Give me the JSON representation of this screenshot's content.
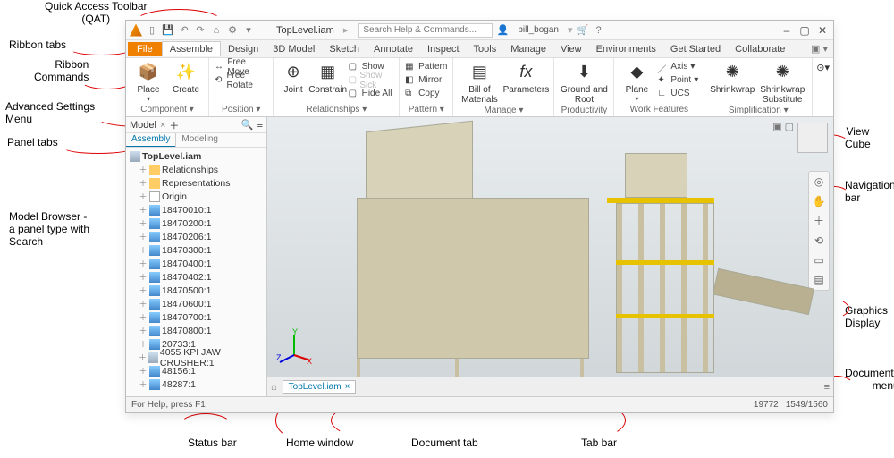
{
  "callouts": {
    "qat": "Quick Access Toolbar\n(QAT)",
    "ribbon_tabs": "Ribbon tabs",
    "ribbon_commands": "Ribbon\nCommands",
    "adv_settings": "Advanced Settings\nMenu",
    "panel_tabs": "Panel tabs",
    "model_browser": "Model Browser -\na panel type with\nSearch",
    "status_bar": "Status bar",
    "home_window": "Home window",
    "document_tab": "Document tab",
    "tab_bar": "Tab bar",
    "view_cube": "View\nCube",
    "nav_bar": "Navigation\nbar",
    "graphics": "Graphics\nDisplay",
    "doc_menu": "Documents\nmenu"
  },
  "qat": {
    "doc": "TopLevel.iam",
    "search_placeholder": "Search Help & Commands...",
    "user": "bill_bogan"
  },
  "ribbon_tabs": [
    "Assemble",
    "Design",
    "3D Model",
    "Sketch",
    "Annotate",
    "Inspect",
    "Tools",
    "Manage",
    "View",
    "Environments",
    "Get Started",
    "Collaborate"
  ],
  "file_tab": "File",
  "panels": {
    "component": {
      "label": "Component ▾",
      "big": [
        "Place",
        "Create"
      ]
    },
    "position": {
      "label": "Position ▾",
      "minis": [
        "Free Move",
        "Free Rotate"
      ]
    },
    "relationships": {
      "label": "Relationships ▾",
      "big": [
        "Joint",
        "Constrain"
      ],
      "minis": [
        "Show",
        "Show Sick",
        "Hide All"
      ]
    },
    "pattern": {
      "label": "Pattern ▾",
      "minis": [
        "Pattern",
        "Mirror",
        "Copy"
      ]
    },
    "manage": {
      "label": "Manage ▾",
      "big": [
        "Bill of\nMaterials",
        "Parameters"
      ]
    },
    "productivity": {
      "label": "Productivity",
      "big": [
        "Ground and\nRoot"
      ]
    },
    "work": {
      "label": "Work Features",
      "big": [
        "Plane"
      ],
      "minis": [
        "Axis",
        "Point",
        "UCS"
      ]
    },
    "simpl": {
      "label": "Simplification ▾",
      "big": [
        "Shrinkwrap",
        "Shrinkwrap\nSubstitute"
      ]
    }
  },
  "browser": {
    "head": "Model",
    "tabs": [
      "Assembly",
      "Modeling"
    ],
    "root": "TopLevel.iam",
    "folders": [
      "Relationships",
      "Representations",
      "Origin"
    ],
    "parts": [
      "18470010:1",
      "18470200:1",
      "18470206:1",
      "18470300:1",
      "18470400:1",
      "18470402:1",
      "18470500:1",
      "18470600:1",
      "18470700:1",
      "18470800:1",
      "20733:1",
      "4055 KPI JAW CRUSHER:1",
      "48156:1",
      "48287:1"
    ]
  },
  "doc_tab": "TopLevel.iam",
  "status": {
    "help": "For Help, press F1",
    "num1": "19772",
    "num2": "1549/1560"
  }
}
